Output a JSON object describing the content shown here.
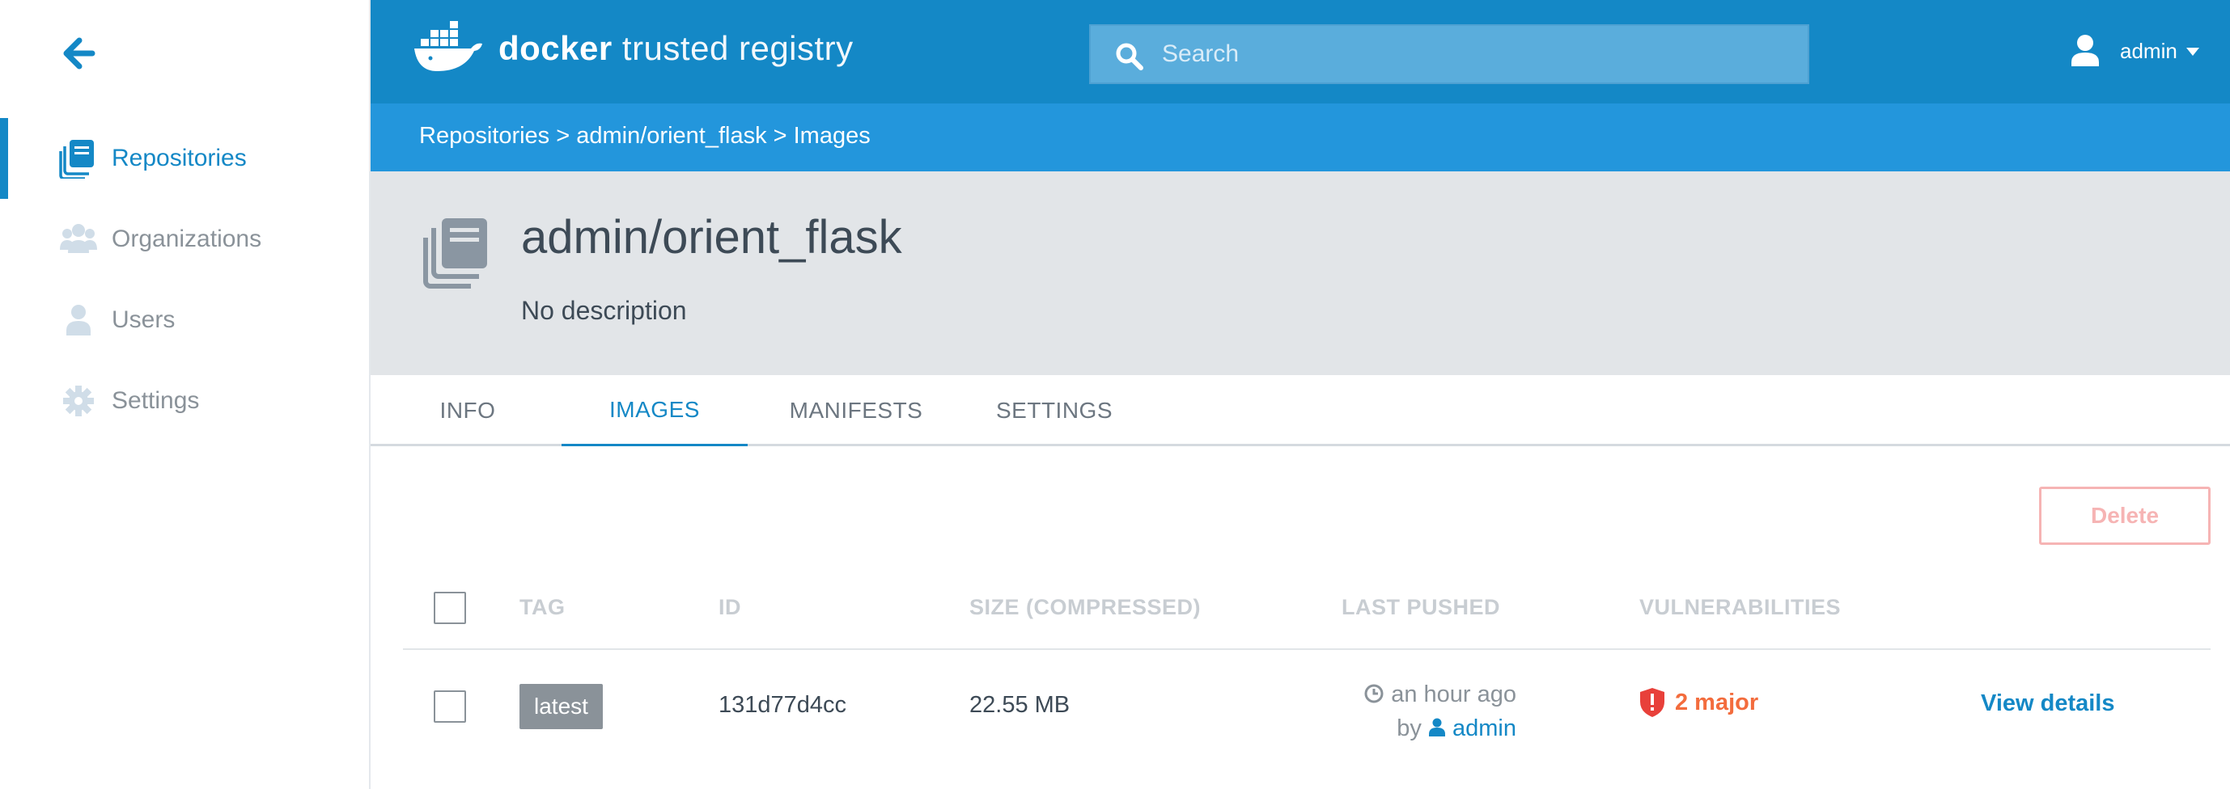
{
  "sidebar": {
    "back_label": "",
    "items": [
      {
        "label": "Repositories",
        "icon": "repositories-icon",
        "active": true
      },
      {
        "label": "Organizations",
        "icon": "organizations-icon",
        "active": false
      },
      {
        "label": "Users",
        "icon": "users-icon",
        "active": false
      },
      {
        "label": "Settings",
        "icon": "settings-gear-icon",
        "active": false
      }
    ]
  },
  "header": {
    "brand_bold": "docker",
    "brand_light": " trusted registry",
    "search_placeholder": "Search",
    "username": "admin"
  },
  "breadcrumb": {
    "text": "Repositories > admin/orient_flask > Images"
  },
  "repo": {
    "title": "admin/orient_flask",
    "description": "No description"
  },
  "tabs": [
    {
      "label": "INFO",
      "active": false
    },
    {
      "label": "IMAGES",
      "active": true
    },
    {
      "label": "MANIFESTS",
      "active": false
    },
    {
      "label": "SETTINGS",
      "active": false
    }
  ],
  "toolbar": {
    "delete_label": "Delete"
  },
  "table": {
    "columns": [
      "TAG",
      "ID",
      "SIZE (COMPRESSED)",
      "LAST PUSHED",
      "VULNERABILITIES"
    ],
    "rows": [
      {
        "tag": "latest",
        "id": "131d77d4cc",
        "size": "22.55 MB",
        "pushed_time": "an hour ago",
        "pushed_by_prefix": "by",
        "pushed_by": "admin",
        "vulnerabilities": "2 major",
        "action": "View details"
      }
    ]
  },
  "colors": {
    "primary": "#1488c6",
    "breadcrumb_bg": "#2396dc",
    "header_bg": "#e2e5e8",
    "danger": "#f36c3d",
    "delete_disabled": "#f6b4b4"
  }
}
